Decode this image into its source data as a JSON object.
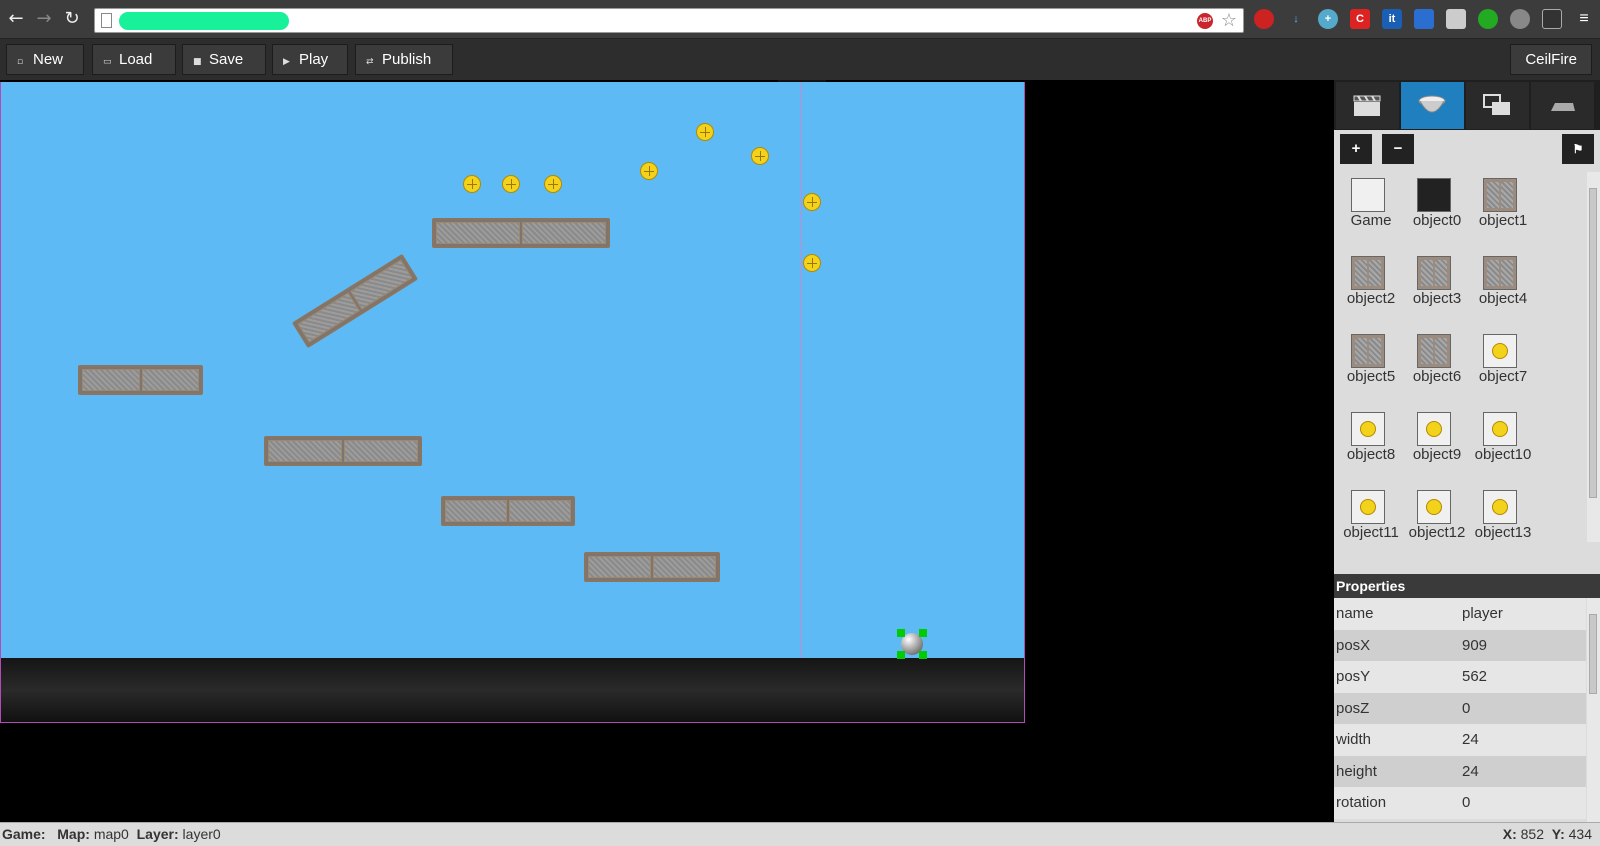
{
  "toolbar": {
    "buttons": [
      {
        "label": "New",
        "icon": "new-file-icon"
      },
      {
        "label": "Load",
        "icon": "folder-icon"
      },
      {
        "label": "Save",
        "icon": "save-icon"
      },
      {
        "label": "Play",
        "icon": "play-icon"
      },
      {
        "label": "Publish",
        "icon": "publish-icon"
      }
    ],
    "user": "CeilFire"
  },
  "panel": {
    "tabs": [
      {
        "icon": "clapperboard-icon",
        "active": false
      },
      {
        "icon": "pot-icon",
        "active": true
      },
      {
        "icon": "windows-icon",
        "active": false
      },
      {
        "icon": "platform-icon",
        "active": false
      }
    ],
    "add_label": "+",
    "remove_label": "−",
    "flag_label": "⚑",
    "objects": [
      {
        "label": "Game",
        "kind": "blank"
      },
      {
        "label": "object0",
        "kind": "dark"
      },
      {
        "label": "object1",
        "kind": "brick"
      },
      {
        "label": "object2",
        "kind": "brick"
      },
      {
        "label": "object3",
        "kind": "brick"
      },
      {
        "label": "object4",
        "kind": "brick"
      },
      {
        "label": "object5",
        "kind": "brick"
      },
      {
        "label": "object6",
        "kind": "brick"
      },
      {
        "label": "object7",
        "kind": "coin"
      },
      {
        "label": "object8",
        "kind": "coin"
      },
      {
        "label": "object9",
        "kind": "coin"
      },
      {
        "label": "object10",
        "kind": "coin"
      },
      {
        "label": "object11",
        "kind": "coin"
      },
      {
        "label": "object12",
        "kind": "coin"
      },
      {
        "label": "object13",
        "kind": "coin"
      }
    ],
    "properties_title": "Properties",
    "properties": [
      {
        "key": "name",
        "value": "player"
      },
      {
        "key": "posX",
        "value": "909"
      },
      {
        "key": "posY",
        "value": "562"
      },
      {
        "key": "posZ",
        "value": "0"
      },
      {
        "key": "width",
        "value": "24"
      },
      {
        "key": "height",
        "value": "24"
      },
      {
        "key": "rotation",
        "value": "0"
      }
    ]
  },
  "status": {
    "game_label": "Game:",
    "game_value": "",
    "map_label": "Map:",
    "map_value": "map0",
    "layer_label": "Layer:",
    "layer_value": "layer0",
    "x_label": "X:",
    "x_value": "852",
    "y_label": "Y:",
    "y_value": "434"
  },
  "colors": {
    "sky": "#5ebaf4",
    "active_tab": "#1f7fbf",
    "selection_handle": "#00cc00",
    "url_highlight": "#19f09a"
  }
}
